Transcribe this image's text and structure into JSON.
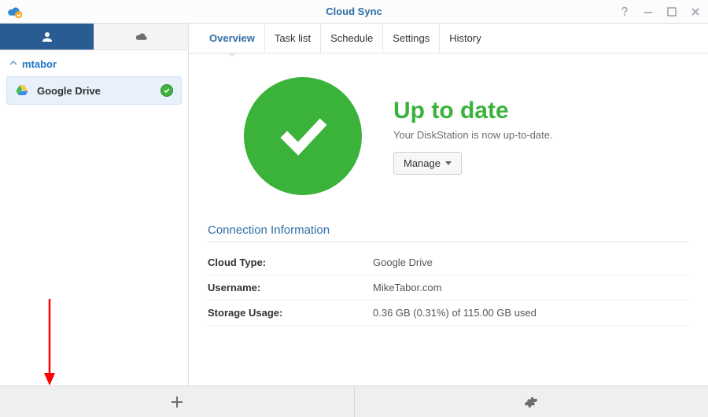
{
  "title": "Cloud Sync",
  "sidebar": {
    "user_group": "mtabor",
    "connection": {
      "name": "Google Drive"
    }
  },
  "tabs": {
    "overview": "Overview",
    "tasklist": "Task list",
    "schedule": "Schedule",
    "settings": "Settings",
    "history": "History"
  },
  "status": {
    "headline": "Up to date",
    "subline": "Your DiskStation is now up-to-date.",
    "manage_label": "Manage"
  },
  "conn_info": {
    "heading": "Connection Information",
    "cloud_type_label": "Cloud Type:",
    "cloud_type_value": "Google Drive",
    "username_label": "Username:",
    "username_value": "MikeTabor.com",
    "storage_label": "Storage Usage:",
    "storage_value": "0.36 GB (0.31%) of 115.00 GB used"
  }
}
